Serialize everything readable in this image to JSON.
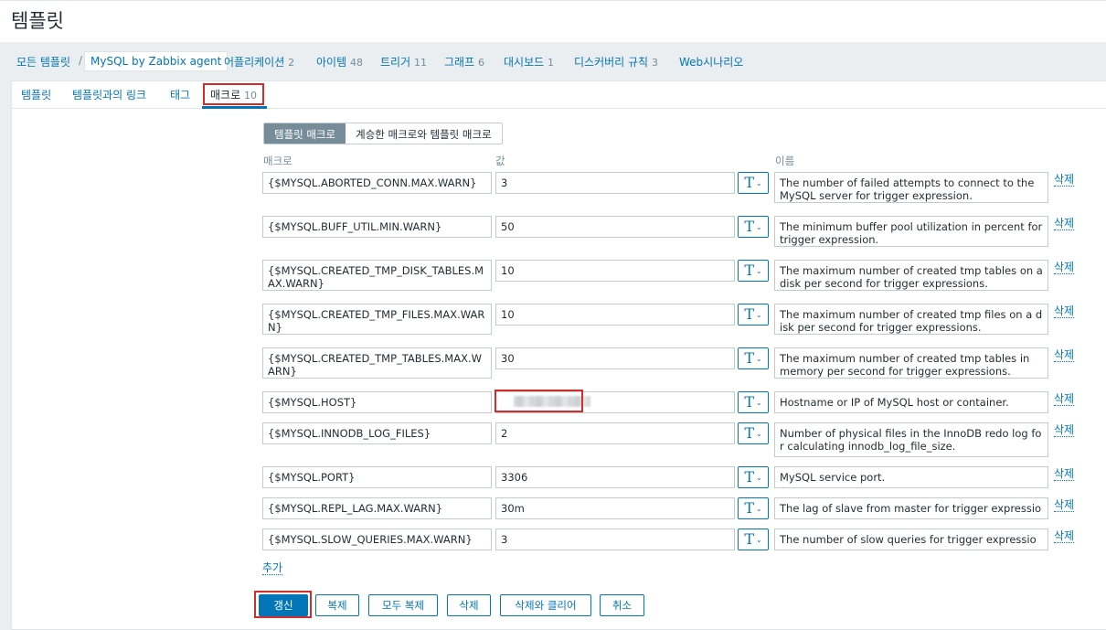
{
  "page_title": "템플릿",
  "breadcrumb": {
    "all_templates": "모든 템플릿",
    "separator": "/",
    "current": "MySQL by Zabbix agent",
    "items": [
      {
        "label": "어플리케이션",
        "count": "2"
      },
      {
        "label": "아이템",
        "count": "48"
      },
      {
        "label": "트리거",
        "count": "11"
      },
      {
        "label": "그래프",
        "count": "6"
      },
      {
        "label": "대시보드",
        "count": "1"
      },
      {
        "label": "디스커버리 규칙",
        "count": "3"
      },
      {
        "label": "Web시나리오",
        "count": ""
      }
    ]
  },
  "tabs": [
    {
      "label": "템플릿",
      "count": ""
    },
    {
      "label": "템플릿과의 링크",
      "count": ""
    },
    {
      "label": "태그",
      "count": ""
    },
    {
      "label": "매크로",
      "count": "10"
    }
  ],
  "segmented": {
    "template_macros": "템플릿 매크로",
    "inherited_macros": "계승한 매크로와 템플릿 매크로"
  },
  "columns": {
    "macro": "매크로",
    "value": "값",
    "description": "이름"
  },
  "type_button": {
    "glyph": "T",
    "chevron": "⌄"
  },
  "remove_label": "삭제",
  "macros": [
    {
      "macro": "{$MYSQL.ABORTED_CONN.MAX.WARN}",
      "value": "3",
      "description": "The number of failed attempts to connect to the MySQL server for trigger expression."
    },
    {
      "macro": "{$MYSQL.BUFF_UTIL.MIN.WARN}",
      "value": "50",
      "description": "The minimum buffer pool utilization in percent for trigger expression."
    },
    {
      "macro": "{$MYSQL.CREATED_TMP_DISK_TABLES.MAX.WARN}",
      "value": "10",
      "description": "The maximum number of created tmp tables on a disk per second for trigger expressions."
    },
    {
      "macro": "{$MYSQL.CREATED_TMP_FILES.MAX.WARN}",
      "value": "10",
      "description": "The maximum number of created tmp files on a disk per second for trigger expressions."
    },
    {
      "macro": "{$MYSQL.CREATED_TMP_TABLES.MAX.WARN}",
      "value": "30",
      "description": "The maximum number of created tmp tables in memory per second for trigger expressions."
    },
    {
      "macro": "{$MYSQL.HOST}",
      "value": "",
      "description": "Hostname or IP of MySQL host or container."
    },
    {
      "macro": "{$MYSQL.INNODB_LOG_FILES}",
      "value": "2",
      "description": "Number of physical files in the InnoDB redo log for calculating innodb_log_file_size."
    },
    {
      "macro": "{$MYSQL.PORT}",
      "value": "3306",
      "description": "MySQL service port."
    },
    {
      "macro": "{$MYSQL.REPL_LAG.MAX.WARN}",
      "value": "30m",
      "description": "The lag of slave from master for trigger expression."
    },
    {
      "macro": "{$MYSQL.SLOW_QUERIES.MAX.WARN}",
      "value": "3",
      "description": "The number of slow queries for trigger expression."
    }
  ],
  "add_label": "추가",
  "buttons": {
    "update": "갱신",
    "clone": "복제",
    "full_clone": "모두 복제",
    "delete": "삭제",
    "delete_and_clear": "삭제와 클리어",
    "cancel": "취소"
  },
  "colors": {
    "link": "#0275b8",
    "highlight": "#d52b2b",
    "muted": "#768d99"
  }
}
